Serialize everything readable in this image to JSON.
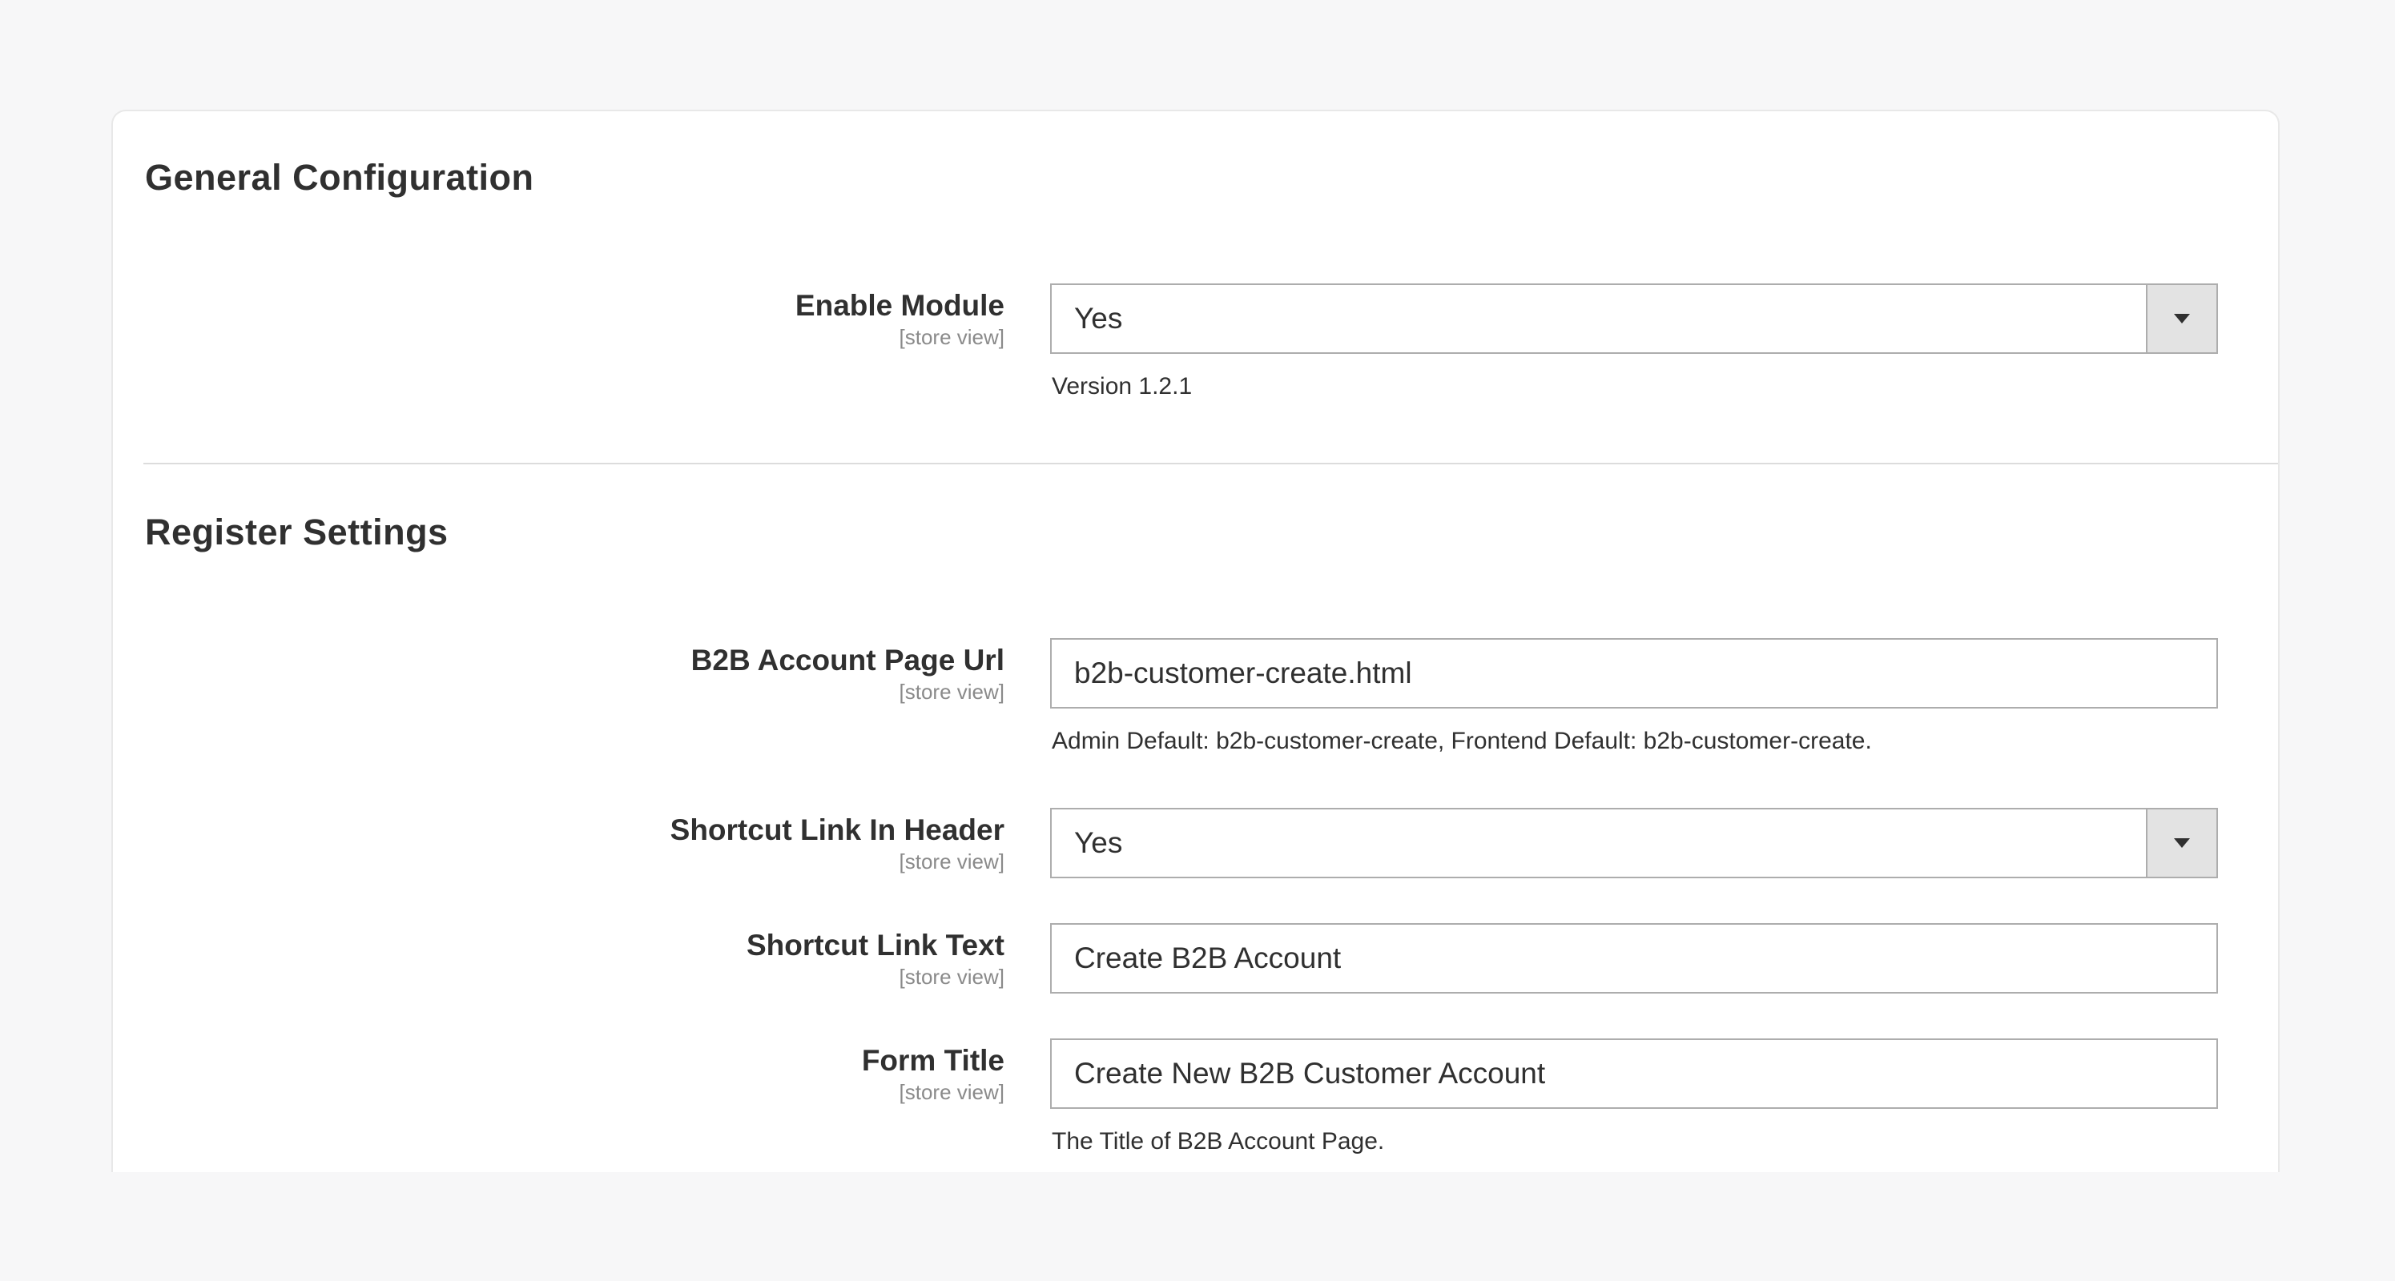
{
  "general": {
    "title": "General Configuration",
    "enable_module": {
      "label": "Enable Module",
      "scope": "[store view]",
      "value": "Yes",
      "note": "Version 1.2.1"
    }
  },
  "register": {
    "title": "Register Settings",
    "account_url": {
      "label": "B2B Account Page Url",
      "scope": "[store view]",
      "value": "b2b-customer-create.html",
      "note": "Admin Default: b2b-customer-create, Frontend Default: b2b-customer-create."
    },
    "shortcut_header": {
      "label": "Shortcut Link In Header",
      "scope": "[store view]",
      "value": "Yes"
    },
    "shortcut_text": {
      "label": "Shortcut Link Text",
      "scope": "[store view]",
      "value": "Create B2B Account"
    },
    "form_title": {
      "label": "Form Title",
      "scope": "[store view]",
      "value": "Create New B2B Customer Account",
      "note": "The Title of B2B Account Page."
    }
  },
  "icons": {
    "select_arrow": "chevron-down-icon"
  },
  "colors": {
    "background": "#f7f7f8",
    "panel": "#ffffff",
    "border": "#adadad",
    "select_button": "#e3e3e3",
    "text": "#303030",
    "scope_text": "#8a8a8a"
  }
}
